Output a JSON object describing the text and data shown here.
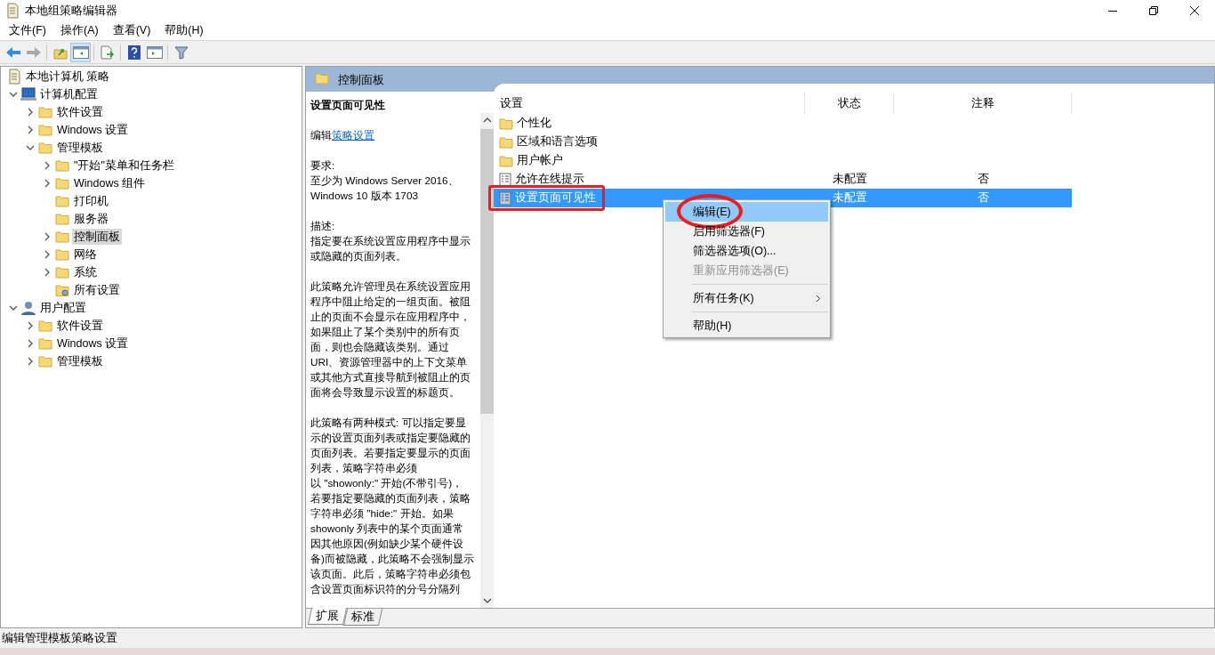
{
  "window": {
    "title": "本地组策略编辑器"
  },
  "menu": [
    "文件(F)",
    "操作(A)",
    "查看(V)",
    "帮助(H)"
  ],
  "toolbar": [
    {
      "pressed": false,
      "disabled": false
    },
    {
      "pressed": false,
      "disabled": true
    },
    {
      "pressed": false,
      "disabled": false
    },
    {
      "pressed": true,
      "disabled": false
    },
    {
      "pressed": false,
      "disabled": false
    },
    {
      "pressed": false,
      "disabled": false
    },
    {
      "pressed": false,
      "disabled": false
    },
    {
      "pressed": false,
      "disabled": false
    }
  ],
  "tree": {
    "label": "本地计算机 策略",
    "kind": "root",
    "selected": false,
    "children": [
      {
        "label": "计算机配置",
        "kind": "computer",
        "selected": false,
        "expanded": true,
        "children": [
          {
            "label": "软件设置",
            "kind": "folder",
            "selected": false,
            "expanded": false
          },
          {
            "label": "Windows 设置",
            "kind": "folder",
            "selected": false,
            "expanded": false
          },
          {
            "label": "管理模板",
            "kind": "folder",
            "selected": false,
            "expanded": true,
            "children": [
              {
                "label": "\"开始\"菜单和任务栏",
                "kind": "folder",
                "selected": false,
                "expanded": false
              },
              {
                "label": "Windows 组件",
                "kind": "folder",
                "selected": false,
                "expanded": false
              },
              {
                "label": "打印机",
                "kind": "folder",
                "selected": false
              },
              {
                "label": "服务器",
                "kind": "folder",
                "selected": false
              },
              {
                "label": "控制面板",
                "kind": "folder",
                "selected": true,
                "expanded": false
              },
              {
                "label": "网络",
                "kind": "folder",
                "selected": false,
                "expanded": false
              },
              {
                "label": "系统",
                "kind": "folder",
                "selected": false,
                "expanded": false
              },
              {
                "label": "所有设置",
                "kind": "settings",
                "selected": false
              }
            ]
          }
        ]
      },
      {
        "label": "用户配置",
        "kind": "user",
        "selected": false,
        "expanded": true,
        "children": [
          {
            "label": "软件设置",
            "kind": "folder",
            "selected": false,
            "expanded": false
          },
          {
            "label": "Windows 设置",
            "kind": "folder",
            "selected": false,
            "expanded": false
          },
          {
            "label": "管理模板",
            "kind": "folder",
            "selected": false,
            "expanded": false
          }
        ]
      }
    ]
  },
  "panel": {
    "title": "控制面板"
  },
  "description": {
    "title": "设置页面可见性",
    "edit_prefix": "编辑",
    "edit_link": "策略设置",
    "sections": [
      {
        "heading": "要求:",
        "lines": [
          "至少为 Windows Server 2016、",
          "Windows 10 版本 1703"
        ]
      },
      {
        "heading": "描述:",
        "lines": [
          "指定要在系统设置应用程序中显示",
          "或隐藏的页面列表。"
        ]
      }
    ],
    "paragraphs": [
      [
        "此策略允许管理员在系统设置应用",
        "程序中阻止给定的一组页面。被阻",
        "止的页面不会显示在应用程序中，",
        "如果阻止了某个类别中的所有页",
        "面，则也会隐藏该类别。通过",
        "URI、资源管理器中的上下文菜单",
        "或其他方式直接导航到被阻止的页",
        "面将会导致显示设置的标题页。"
      ],
      [
        "此策略有两种模式: 可以指定要显",
        "示的设置页面列表或指定要隐藏的",
        "页面列表。若要指定要显示的页面",
        "列表，策略字符串必须",
        "以 \"showonly:\" 开始(不带引号)，",
        "若要指定要隐藏的页面列表，策略",
        "字符串必须 \"hide:\" 开始。如果",
        "showonly 列表中的某个页面通常",
        "因其他原因(例如缺少某个硬件设",
        "备)而被隐藏，此策略不会强制显示",
        "该页面。此后，策略字符串必须包",
        "含设置页面标识符的分号分隔列"
      ]
    ]
  },
  "tabs": [
    {
      "label": "扩展",
      "selected": true
    },
    {
      "label": "标准",
      "selected": false
    }
  ],
  "table": {
    "columns": [
      "设置",
      "状态",
      "注释"
    ],
    "rows": [
      {
        "kind": "folder",
        "name": "个性化",
        "selected": false,
        "boxed": false
      },
      {
        "kind": "folder",
        "name": "区域和语言选项",
        "selected": false,
        "boxed": false
      },
      {
        "kind": "folder",
        "name": "用户帐户",
        "selected": false,
        "boxed": false
      },
      {
        "kind": "policy",
        "name": "允许在线提示",
        "state": "未配置",
        "comment": "否",
        "selected": false,
        "boxed": false
      },
      {
        "kind": "policy",
        "name": "设置页面可见性",
        "state": "未配置",
        "comment": "否",
        "selected": true,
        "boxed": true
      }
    ]
  },
  "context_menu": [
    {
      "kind": "item",
      "label": "编辑(E)",
      "selected": true,
      "disabled": false,
      "submenu": false,
      "circled": true
    },
    {
      "kind": "item",
      "label": "启用筛选器(F)",
      "selected": false,
      "disabled": false,
      "submenu": false,
      "circled": false
    },
    {
      "kind": "item",
      "label": "筛选器选项(O)...",
      "selected": false,
      "disabled": false,
      "submenu": false,
      "circled": false
    },
    {
      "kind": "item",
      "label": "重新应用筛选器(E)",
      "selected": false,
      "disabled": true,
      "submenu": false,
      "circled": false
    },
    {
      "kind": "separator"
    },
    {
      "kind": "item",
      "label": "所有任务(K)",
      "selected": false,
      "disabled": false,
      "submenu": true,
      "circled": false
    },
    {
      "kind": "separator"
    },
    {
      "kind": "item",
      "label": "帮助(H)",
      "selected": false,
      "disabled": false,
      "submenu": false,
      "circled": false
    }
  ],
  "status_bar": "编辑管理模板策略设置"
}
